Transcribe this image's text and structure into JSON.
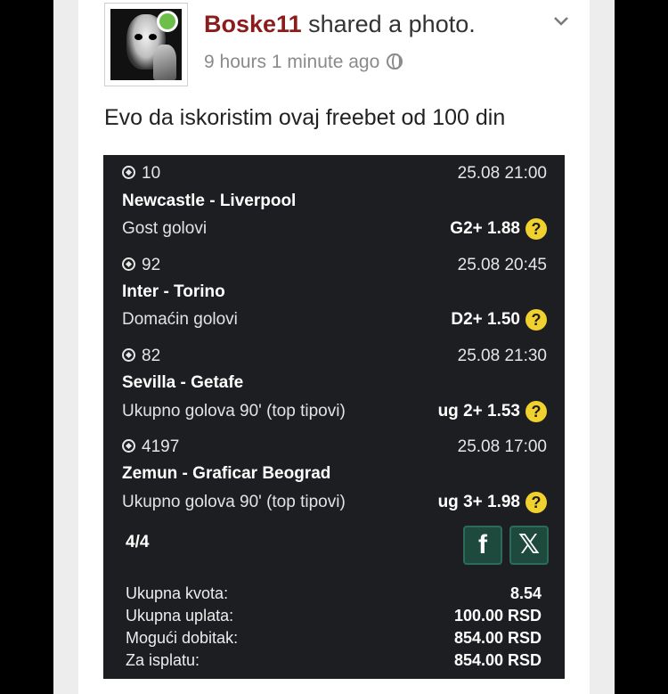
{
  "post": {
    "username": "Boske11",
    "action": " shared a photo.",
    "time": "9 hours 1 minute ago",
    "text": "Evo da iskoristim ovaj freebet od 100 din"
  },
  "icons": {
    "globe": "globe-icon",
    "chevron": "chevron-down-icon",
    "ball": "soccer-ball-icon",
    "help": "question-mark-icon",
    "facebook": "facebook-icon",
    "x": "x-icon"
  },
  "colors": {
    "username": "#8b1c1c",
    "online": "#6cc04a",
    "ticket_bg": "#1d1e21",
    "help_badge": "#f1d12e",
    "share_bg": "#1e4a3e"
  },
  "ticket": {
    "bets": [
      {
        "code": "10",
        "datetime": "25.08 21:00",
        "match": "Newcastle - Liverpool",
        "market": "Gost golovi",
        "odd": "G2+ 1.88"
      },
      {
        "code": "92",
        "datetime": "25.08 20:45",
        "match": "Inter - Torino",
        "market": "Domaćin golovi",
        "odd": "D2+ 1.50"
      },
      {
        "code": "82",
        "datetime": "25.08 21:30",
        "match": "Sevilla - Getafe",
        "market": "Ukupno golova 90' (top tipovi)",
        "odd": "ug 2+ 1.53"
      },
      {
        "code": "4197",
        "datetime": "25.08 17:00",
        "match": "Zemun - Graficar Beograd",
        "market": "Ukupno golova 90' (top tipovi)",
        "odd": "ug 3+ 1.98"
      }
    ],
    "help_symbol": "?",
    "count": "4/4",
    "share": {
      "facebook": "f",
      "x": "𝕏"
    },
    "summary": [
      {
        "label": "Ukupna kvota:",
        "value": "8.54"
      },
      {
        "label": "Ukupna uplata:",
        "value": "100.00 RSD"
      },
      {
        "label": "Mogući dobitak:",
        "value": "854.00 RSD"
      },
      {
        "label": "Za isplatu:",
        "value": "854.00 RSD"
      }
    ]
  }
}
